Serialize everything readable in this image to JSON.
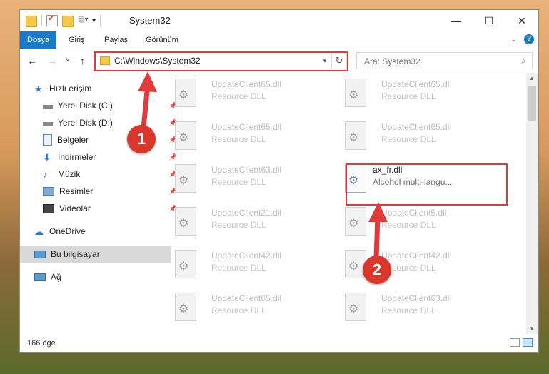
{
  "window": {
    "title": "System32",
    "controls": {
      "minimize": "—",
      "maximize": "☐",
      "close": "✕"
    }
  },
  "ribbon": {
    "tabs": [
      "Dosya",
      "Giriş",
      "Paylaş",
      "Görünüm"
    ],
    "collapse_icon": "chevron-down-icon",
    "help_label": "?"
  },
  "nav": {
    "back": "←",
    "forward": "→",
    "recent": "˅",
    "up": "↑",
    "address": "C:\\Windows\\System32",
    "dropdown": "▾",
    "refresh": "↻",
    "search_placeholder": "Ara: System32",
    "search_icon": "⌕"
  },
  "sidebar": {
    "items": [
      {
        "label": "Hızlı erişim",
        "icon": "star-icon"
      },
      {
        "label": "Yerel Disk (C:)",
        "icon": "drive-icon"
      },
      {
        "label": "Yerel Disk (D:)",
        "icon": "drive-icon"
      },
      {
        "label": "Belgeler",
        "icon": "documents-icon"
      },
      {
        "label": "İndirmeler",
        "icon": "download-icon"
      },
      {
        "label": "Müzik",
        "icon": "music-icon"
      },
      {
        "label": "Resimler",
        "icon": "pictures-icon"
      },
      {
        "label": "Videolar",
        "icon": "videos-icon"
      },
      {
        "label": "OneDrive",
        "icon": "cloud-icon"
      },
      {
        "label": "Bu bilgisayar",
        "icon": "computer-icon"
      },
      {
        "label": "Ağ",
        "icon": "network-icon"
      }
    ],
    "pin": "📌"
  },
  "files": [
    {
      "name": "UpdateClient65.dll",
      "desc": "Resource DLL"
    },
    {
      "name": "UpdateClient65.dll",
      "desc": "Resource DLL"
    },
    {
      "name": "UpdateClient65.dll",
      "desc": "Resource DLL"
    },
    {
      "name": "UpdateClient65.dll",
      "desc": "Resource DLL"
    },
    {
      "name": "UpdateClient63.dll",
      "desc": "Resource DLL"
    },
    {
      "name": "ax_fr.dll",
      "desc": "Alcohol multi-langu..."
    },
    {
      "name": "UpdateClient21.dll",
      "desc": "Resource DLL"
    },
    {
      "name": "UpdateClient5.dll",
      "desc": "Resource DLL"
    },
    {
      "name": "UpdateClient42.dll",
      "desc": "Resource DLL"
    },
    {
      "name": "UpdateClient42.dll",
      "desc": "Resource DLL"
    },
    {
      "name": "UpdateClient65.dll",
      "desc": "Resource DLL"
    },
    {
      "name": "UpdateClient63.dll",
      "desc": "Resource DLL"
    }
  ],
  "status": {
    "count": "166 öğe"
  },
  "annotations": {
    "badge1": "1",
    "badge2": "2"
  },
  "colors": {
    "accent": "#1979ca",
    "highlight": "#e03a3a"
  }
}
